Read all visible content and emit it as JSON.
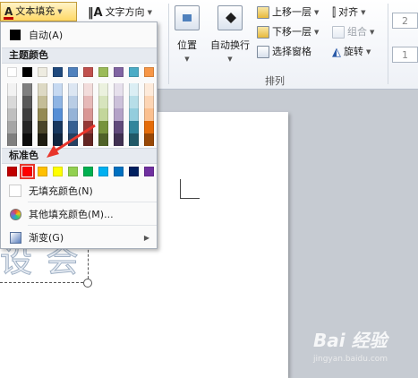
{
  "ribbon": {
    "text_fill_label": "文本填充",
    "text_direction_label": "文字方向",
    "position_label": "位置",
    "auto_wrap_label": "自动换行",
    "bring_forward_label": "上移一层",
    "send_backward_label": "下移一层",
    "selection_pane_label": "选择窗格",
    "align_label": "对齐",
    "group_label": "组合",
    "rotate_label": "旋转",
    "arrange_group_label": "排列",
    "spin_value_1": "2",
    "spin_value_2": "1"
  },
  "menu": {
    "auto_label": "自动(A)",
    "theme_colors_header": "主题颜色",
    "standard_colors_header": "标准色",
    "no_fill_label": "无填充颜色(N)",
    "more_colors_label": "其他填充颜色(M)...",
    "gradient_label": "渐变(G)",
    "theme_top_row": [
      "#ffffff",
      "#000000",
      "#eeece1",
      "#1f497d",
      "#4f81bd",
      "#c0504d",
      "#9bbb59",
      "#8064a2",
      "#4bacc6",
      "#f79646"
    ],
    "theme_columns": [
      [
        "#f2f2f2",
        "#d9d9d9",
        "#bfbfbf",
        "#a6a6a6",
        "#7f7f7f"
      ],
      [
        "#7f7f7f",
        "#595959",
        "#3f3f3f",
        "#262626",
        "#0c0c0c"
      ],
      [
        "#ddd9c4",
        "#c4bd97",
        "#948a54",
        "#4a452a",
        "#1e1c11"
      ],
      [
        "#c6d9f1",
        "#8eb4e3",
        "#558ed5",
        "#17375e",
        "#10253f"
      ],
      [
        "#dce6f2",
        "#b9cde5",
        "#95b3d7",
        "#376092",
        "#254061"
      ],
      [
        "#f2dcdb",
        "#e6b9b8",
        "#d99694",
        "#953735",
        "#632523"
      ],
      [
        "#ebf1de",
        "#d7e4bd",
        "#c3d69b",
        "#77933c",
        "#4f6228"
      ],
      [
        "#e6e0ec",
        "#ccc1da",
        "#b3a2c7",
        "#604a7b",
        "#403152"
      ],
      [
        "#dbeef4",
        "#b7dee8",
        "#93cddd",
        "#31859c",
        "#215968"
      ],
      [
        "#fdeada",
        "#fcd5b5",
        "#fac090",
        "#e46c0a",
        "#984807"
      ]
    ],
    "standard_colors": [
      "#c00000",
      "#ff0000",
      "#ffc000",
      "#ffff00",
      "#92d050",
      "#00b050",
      "#00b0f0",
      "#0070c0",
      "#002060",
      "#7030a0"
    ],
    "selected_standard_color": "#ff0000"
  },
  "canvas": {
    "bg_text": "设 会"
  },
  "watermark": {
    "brand": "Bai 经验",
    "url": "jingyan.baidu.com"
  }
}
